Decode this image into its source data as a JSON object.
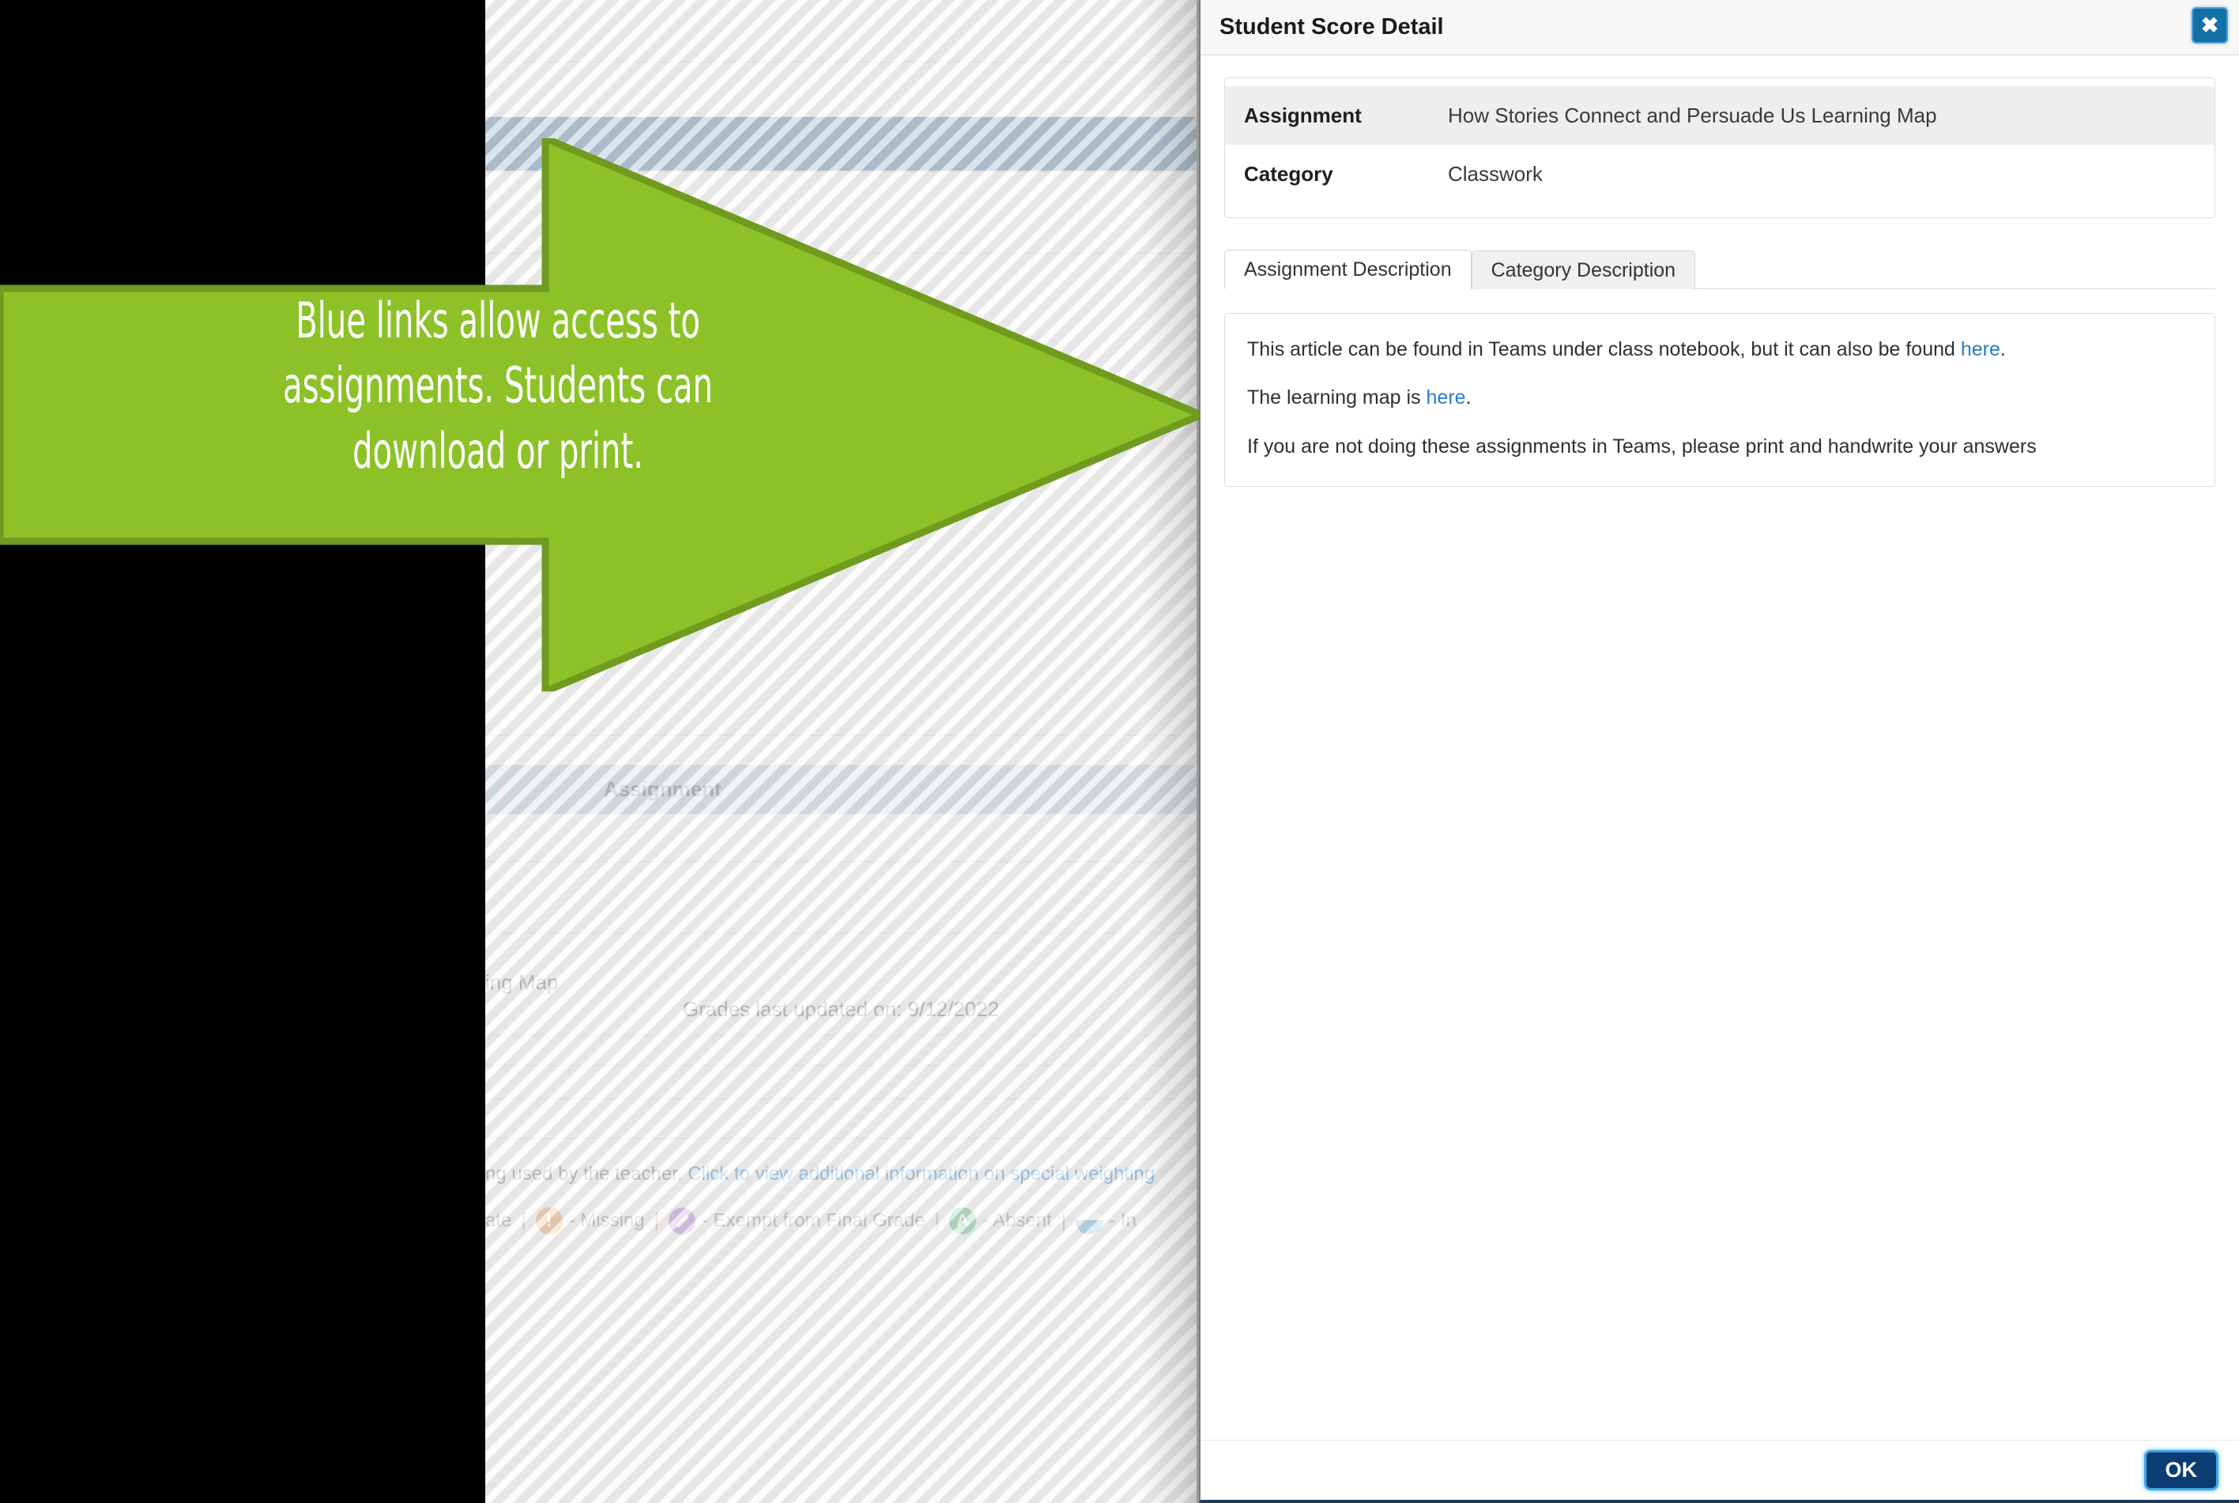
{
  "background": {
    "assignment_column_header": "Assignment",
    "row_title_clipped": "ing Map",
    "last_updated": "Grades last updated on: 9/12/2022",
    "weighting_note_prefix": "ng used by the teacher. ",
    "weighting_note_link": "Click to view additional information on special weighting",
    "legend": {
      "late_label_clipped": "ate",
      "missing_label": "- Missing",
      "exempt_label": "- Exempt from Final Grade",
      "absent_label": "- Absent",
      "incomplete_label_clipped": "- In",
      "separator": "|",
      "icons": {
        "missing": "exclamation-circle-icon",
        "exempt": "slash-circle-icon",
        "absent": "absent-circle-icon",
        "incomplete": "half-filled-circle-icon"
      }
    },
    "colors": {
      "blue_bar": "#6f93b3",
      "header_row": "#bfd0d9",
      "link": "#3f8fd0"
    }
  },
  "callout": {
    "text": "Blue links allow access to\nassignments. Students can\ndownload or print.",
    "fill_color": "#8cc228",
    "stroke_color": "#6f9b1e",
    "text_color": "#ffffff"
  },
  "modal": {
    "title": "Student Score Detail",
    "close_label": "✖",
    "close_icon": "close-icon",
    "info": [
      {
        "label": "Assignment",
        "value": "How Stories Connect and Persuade Us Learning Map"
      },
      {
        "label": "Category",
        "value": "Classwork"
      }
    ],
    "tabs": [
      {
        "label": "Assignment Description",
        "active": true
      },
      {
        "label": "Category Description",
        "active": false
      }
    ],
    "description": {
      "line1_before": "This article can be found in Teams under class notebook, but it can also be found ",
      "line1_link": "here",
      "line1_after": ".",
      "line2_before": "The learning map is ",
      "line2_link": "here",
      "line2_after": ".",
      "line3": "If you are not doing these assignments in Teams, please print and handwrite your answers"
    },
    "ok_label": "OK",
    "colors": {
      "link": "#2b7cc0",
      "ok_button": "#0b3d73",
      "close_button": "#1471a8"
    }
  }
}
